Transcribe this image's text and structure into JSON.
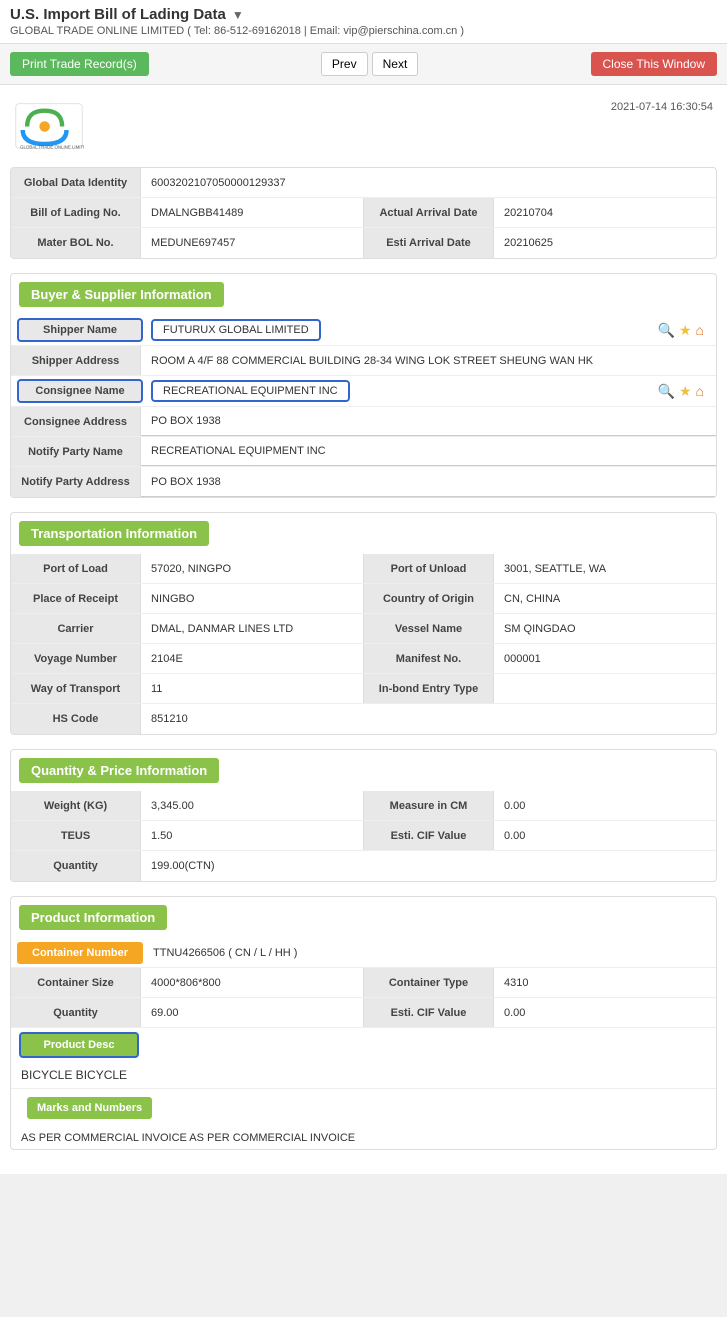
{
  "header": {
    "title": "U.S. Import Bill of Lading Data",
    "subtitle": "GLOBAL TRADE ONLINE LIMITED ( Tel: 86-512-69162018 | Email: vip@pierschina.com.cn )",
    "datetime": "2021-07-14 16:30:54"
  },
  "toolbar": {
    "print_label": "Print Trade Record(s)",
    "prev_label": "Prev",
    "next_label": "Next",
    "close_label": "Close This Window"
  },
  "record": {
    "global_data_identity_label": "Global Data Identity",
    "global_data_identity_value": "600320210705000012933  7",
    "bill_of_lading_label": "Bill of Lading No.",
    "bill_of_lading_value": "DMALNGBB41489",
    "actual_arrival_label": "Actual Arrival Date",
    "actual_arrival_value": "20210704",
    "mater_bol_label": "Mater BOL No.",
    "mater_bol_value": "MEDUNE697457",
    "esti_arrival_label": "Esti Arrival Date",
    "esti_arrival_value": "20210625"
  },
  "buyer_supplier": {
    "section_title": "Buyer & Supplier Information",
    "shipper_name_label": "Shipper Name",
    "shipper_name_value": "FUTURUX GLOBAL LIMITED",
    "shipper_address_label": "Shipper Address",
    "shipper_address_value": "ROOM A 4/F 88 COMMERCIAL BUILDING 28-34 WING LOK STREET SHEUNG WAN HK",
    "consignee_name_label": "Consignee Name",
    "consignee_name_value": "RECREATIONAL EQUIPMENT INC",
    "consignee_address_label": "Consignee Address",
    "consignee_address_value": "PO BOX 1938",
    "notify_party_name_label": "Notify Party Name",
    "notify_party_name_value": "RECREATIONAL EQUIPMENT INC",
    "notify_party_address_label": "Notify Party Address",
    "notify_party_address_value": "PO BOX 1938"
  },
  "transportation": {
    "section_title": "Transportation Information",
    "port_of_load_label": "Port of Load",
    "port_of_load_value": "57020, NINGPO",
    "port_of_unload_label": "Port of Unload",
    "port_of_unload_value": "3001, SEATTLE, WA",
    "place_of_receipt_label": "Place of Receipt",
    "place_of_receipt_value": "NINGBO",
    "country_of_origin_label": "Country of Origin",
    "country_of_origin_value": "CN, CHINA",
    "carrier_label": "Carrier",
    "carrier_value": "DMAL, DANMAR LINES LTD",
    "vessel_name_label": "Vessel Name",
    "vessel_name_value": "SM QINGDAO",
    "voyage_number_label": "Voyage Number",
    "voyage_number_value": "2104E",
    "manifest_no_label": "Manifest No.",
    "manifest_no_value": "000001",
    "way_of_transport_label": "Way of Transport",
    "way_of_transport_value": "11",
    "in_bond_entry_label": "In-bond Entry Type",
    "in_bond_entry_value": "",
    "hs_code_label": "HS Code",
    "hs_code_value": "851210"
  },
  "quantity_price": {
    "section_title": "Quantity & Price Information",
    "weight_label": "Weight (KG)",
    "weight_value": "3,345.00",
    "measure_label": "Measure in CM",
    "measure_value": "0.00",
    "teus_label": "TEUS",
    "teus_value": "1.50",
    "esti_cif_label": "Esti. CIF Value",
    "esti_cif_value": "0.00",
    "quantity_label": "Quantity",
    "quantity_value": "199.00(CTN)"
  },
  "product": {
    "section_title": "Product Information",
    "container_number_label": "Container Number",
    "container_number_value": "TTNU4266506 ( CN / L / HH )",
    "container_size_label": "Container Size",
    "container_size_value": "4000*806*800",
    "container_type_label": "Container Type",
    "container_type_value": "4310",
    "quantity_label": "Quantity",
    "quantity_value": "69.00",
    "esti_cif_label": "Esti. CIF Value",
    "esti_cif_value": "0.00",
    "product_desc_label": "Product Desc",
    "product_desc_value": "BICYCLE BICYCLE",
    "marks_label": "Marks and Numbers",
    "marks_value": "AS PER COMMERCIAL INVOICE AS PER COMMERCIAL INVOICE"
  },
  "global_id_corrected": "6003202107050000129337"
}
